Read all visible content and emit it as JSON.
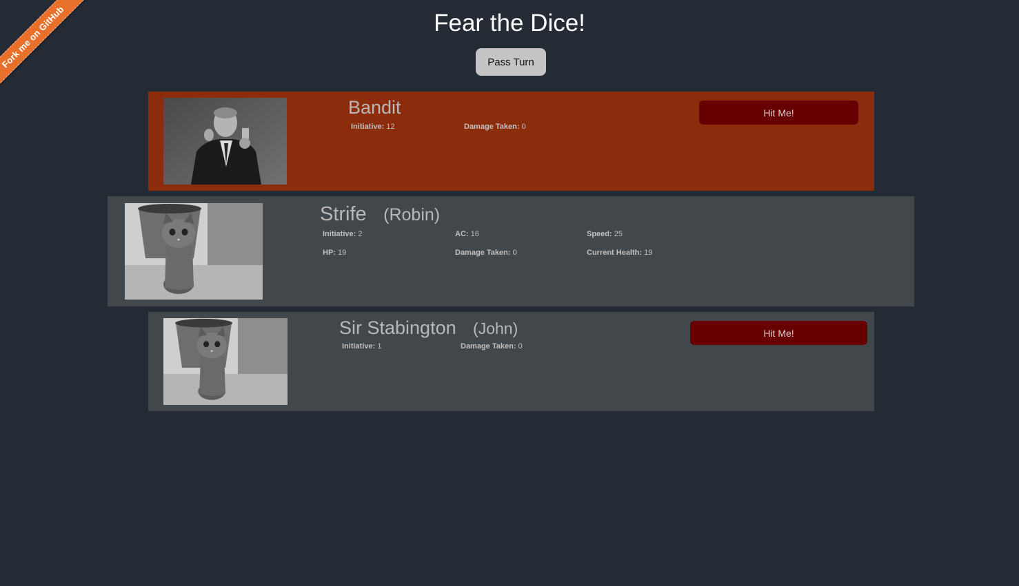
{
  "ribbon": {
    "label": "Fork me on GitHub",
    "color": "#e8702a"
  },
  "header": {
    "title": "Fear the Dice!",
    "pass_turn_label": "Pass Turn"
  },
  "colors": {
    "background": "#252b35",
    "active_card": "#8b2d0c",
    "inactive_card": "#42474c",
    "hit_button": "#670000"
  },
  "cards": [
    {
      "name": "Bandit",
      "portrait": "man-in-suit-photo",
      "stats": [
        {
          "label": "Initiative:",
          "value": "12"
        },
        {
          "label": "Damage Taken:",
          "value": "0"
        }
      ],
      "hit_label": "Hit Me!"
    },
    {
      "name": "Strife",
      "player": "(Robin)",
      "portrait": "kitten-photo",
      "stats": [
        {
          "label": "Initiative:",
          "value": "2"
        },
        {
          "label": "AC:",
          "value": "16"
        },
        {
          "label": "Speed:",
          "value": "25"
        },
        {
          "label": "HP:",
          "value": "19"
        },
        {
          "label": "Damage Taken:",
          "value": "0"
        },
        {
          "label": "Current Health:",
          "value": "19"
        }
      ]
    },
    {
      "name": "Sir Stabington",
      "player": "(John)",
      "portrait": "kitten-photo",
      "stats": [
        {
          "label": "Initiative:",
          "value": "1"
        },
        {
          "label": "Damage Taken:",
          "value": "0"
        }
      ],
      "hit_label": "Hit Me!"
    }
  ]
}
